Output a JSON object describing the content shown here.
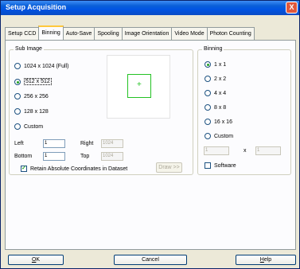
{
  "window": {
    "title": "Setup Acquisition",
    "close_glyph": "X"
  },
  "tabs": [
    {
      "label": "Setup CCD",
      "active": false
    },
    {
      "label": "Binning",
      "active": true
    },
    {
      "label": "Auto-Save",
      "active": false
    },
    {
      "label": "Spooling",
      "active": false
    },
    {
      "label": "Image Orientation",
      "active": false
    },
    {
      "label": "Video Mode",
      "active": false
    },
    {
      "label": "Photon Counting",
      "active": false
    }
  ],
  "sub_image": {
    "label": "Sub Image",
    "options": [
      "1024 x 1024 (Full)",
      "512 x 512",
      "256 x 256",
      "128 x 128",
      "Custom"
    ],
    "selected": "512 x 512",
    "left_label": "Left",
    "left_value": "1",
    "right_label": "Right",
    "right_value": "1024",
    "bottom_label": "Bottom",
    "bottom_value": "1",
    "top_label": "Top",
    "top_value": "1024",
    "retain_label": "Retain Absolute Coordinates in Dataset",
    "retain_checked": true,
    "draw_button": "Draw >>",
    "cross_glyph": "+"
  },
  "binning": {
    "label": "Binning",
    "options": [
      "1 x 1",
      "2 x 2",
      "4 x 4",
      "8 x 8",
      "16 x 16",
      "Custom"
    ],
    "selected": "1 x 1",
    "custom_x_value": "1",
    "custom_y_value": "1",
    "x_separator": "x",
    "software_label": "Software",
    "software_checked": false
  },
  "buttons": {
    "ok_prefix": "",
    "ok_underlined": "O",
    "ok_rest": "K",
    "cancel": "Cancel",
    "help_underlined": "H",
    "help_rest": "elp"
  },
  "colors": {
    "titlebar": "#0054e3",
    "roi": "#23c223",
    "radio_dot": "#21a121"
  }
}
